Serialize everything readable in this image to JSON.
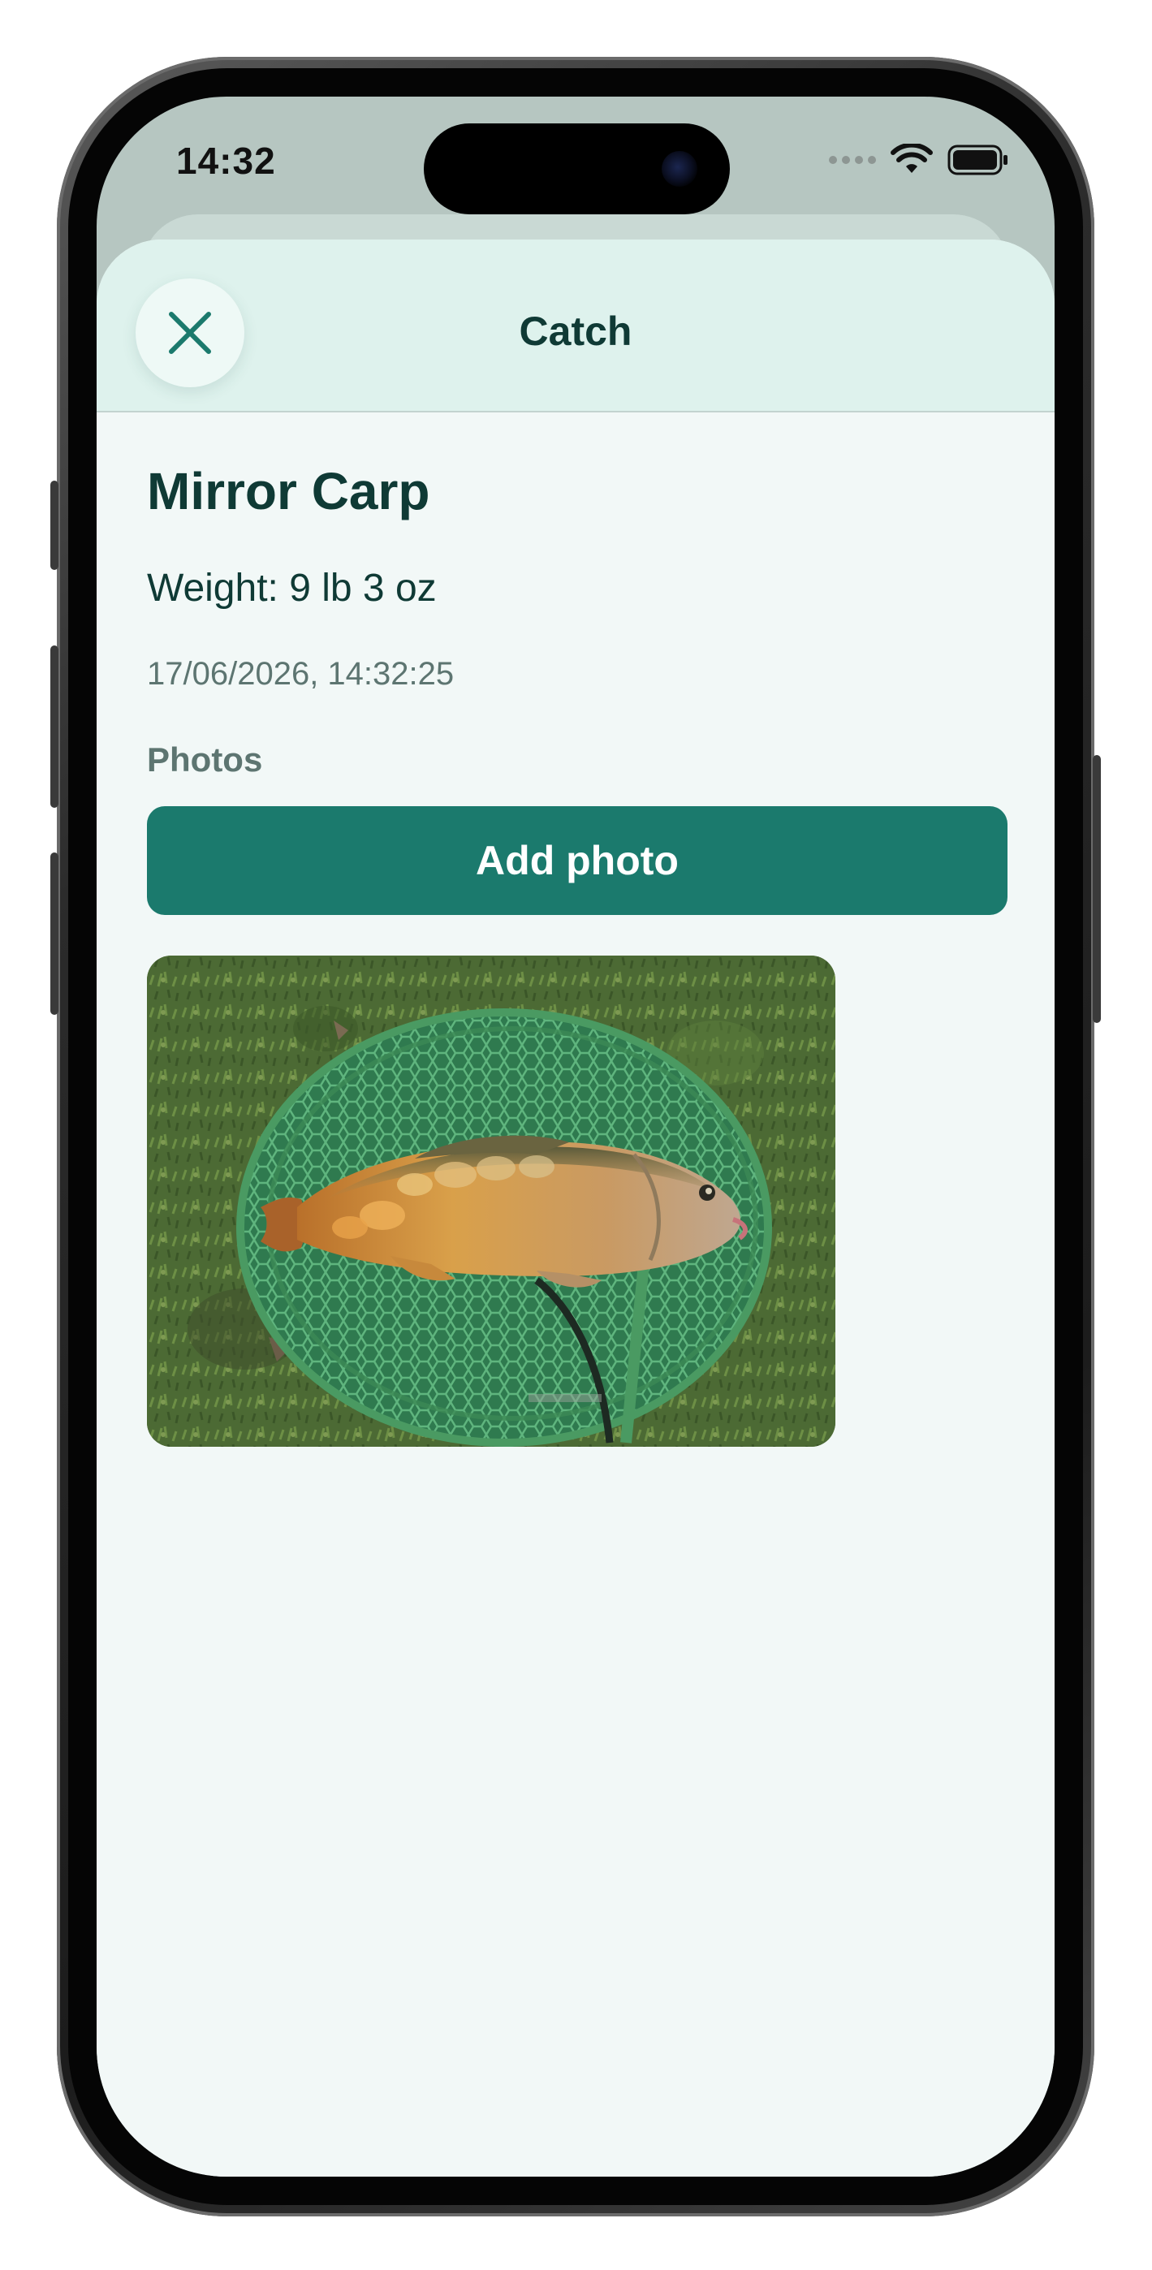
{
  "status_bar": {
    "time": "14:32"
  },
  "sheet": {
    "title": "Catch",
    "close_icon": "close-icon"
  },
  "catch": {
    "species": "Mirror Carp",
    "weight_text": "Weight: 9 lb 3 oz",
    "timestamp": "17/06/2026, 14:32:25"
  },
  "photos": {
    "section_label": "Photos",
    "add_button_label": "Add photo",
    "items": [
      {
        "subject": "mirror-carp-in-landing-net"
      }
    ]
  },
  "colors": {
    "accent": "#1b7a6d",
    "header_bg": "#def2ed",
    "sheet_bg": "#f2f8f7",
    "title_text": "#0f3a35",
    "secondary_text": "#5d7571"
  }
}
